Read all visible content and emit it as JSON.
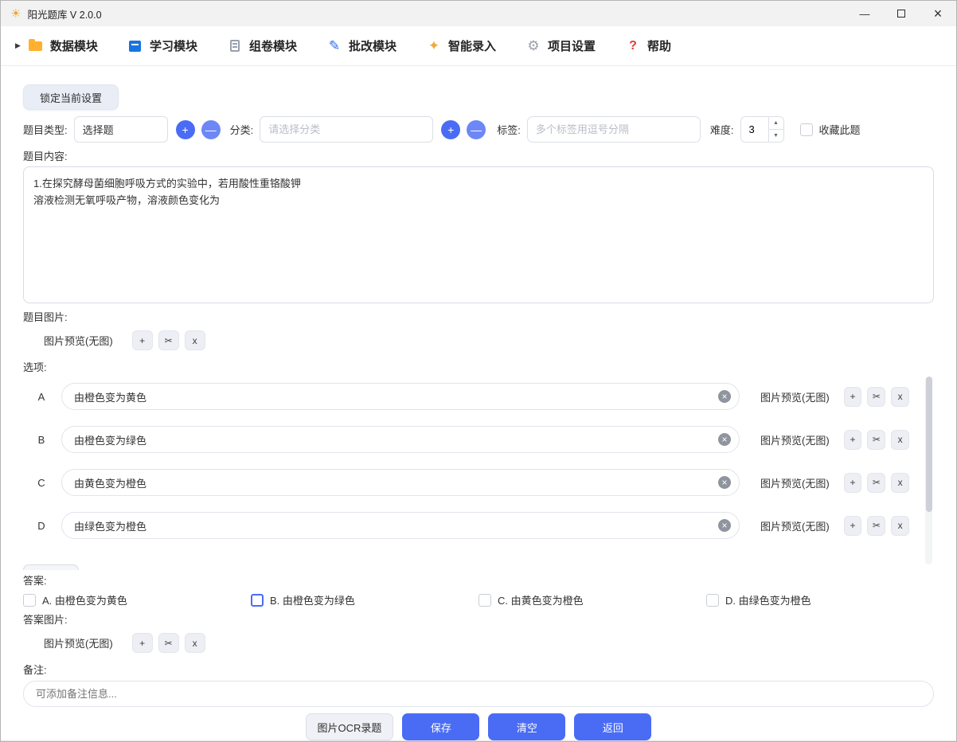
{
  "window": {
    "title": "阳光题库 V 2.0.0"
  },
  "icons": {
    "sun": "☀",
    "expand_arrow": "▶",
    "pencil": "✎",
    "sparkle": "✦",
    "gear": "⚙",
    "help": "?",
    "minimize": "—",
    "close": "×",
    "clear": "×",
    "spin_up": "▲",
    "spin_down": "▼",
    "add": "+",
    "crop": "✂",
    "remove": "x"
  },
  "nav": {
    "items": [
      {
        "label": "数据模块"
      },
      {
        "label": "学习模块"
      },
      {
        "label": "组卷模块"
      },
      {
        "label": "批改模块"
      },
      {
        "label": "智能录入"
      },
      {
        "label": "项目设置"
      },
      {
        "label": "帮助"
      }
    ]
  },
  "form": {
    "lock_button": "锁定当前设置",
    "type_label": "题目类型:",
    "type_value": "选择题",
    "category_label": "分类:",
    "category_placeholder": "请选择分类",
    "tags_label": "标签:",
    "tags_placeholder": "多个标签用逗号分隔",
    "difficulty_label": "难度:",
    "difficulty_value": "3",
    "favorite_label": "收藏此题",
    "content_label": "题目内容:",
    "content_value": "1.在探究酵母菌细胞呼吸方式的实验中，若用酸性重铬酸钾\n溶液检测无氧呼吸产物，溶液颜色变化为",
    "question_image_label": "题目图片:",
    "options_label": "选项:",
    "answers_label": "答案:",
    "answer_image_label": "答案图片:",
    "remark_label": "备注:",
    "remark_placeholder": "可添加备注信息..."
  },
  "image_tools": {
    "preview_label": "图片预览(无图)"
  },
  "options": [
    {
      "letter": "A",
      "text": "由橙色变为黄色"
    },
    {
      "letter": "B",
      "text": "由橙色变为绿色"
    },
    {
      "letter": "C",
      "text": "由黄色变为橙色"
    },
    {
      "letter": "D",
      "text": "由绿色变为橙色"
    }
  ],
  "answers": [
    {
      "label": "A. 由橙色变为黄色",
      "checked": false
    },
    {
      "label": "B. 由橙色变为绿色",
      "checked": false
    },
    {
      "label": "C. 由黄色变为橙色",
      "checked": false
    },
    {
      "label": "D. 由绿色变为橙色",
      "checked": false
    }
  ],
  "actions": {
    "ocr": "图片OCR录题",
    "save": "保存",
    "clear": "清空",
    "back": "返回"
  },
  "colors": {
    "accent": "#4a6cf5"
  }
}
